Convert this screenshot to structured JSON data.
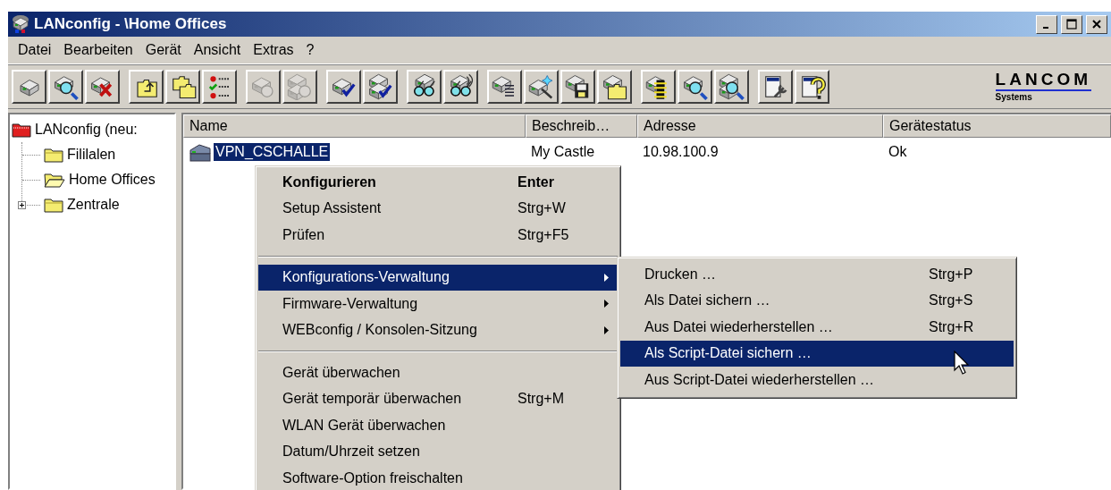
{
  "window": {
    "title": "LANconfig - \\Home Offices"
  },
  "menu_bar": [
    "Datei",
    "Bearbeiten",
    "Gerät",
    "Ansicht",
    "Extras",
    "?"
  ],
  "toolbar": [
    {
      "buttons": [
        {
          "kind": "device",
          "disabled": false
        },
        {
          "kind": "device-search",
          "disabled": false
        },
        {
          "kind": "device-delete",
          "disabled": false
        }
      ]
    },
    {
      "buttons": [
        {
          "kind": "folder-up",
          "disabled": false
        },
        {
          "kind": "folders",
          "disabled": false
        },
        {
          "kind": "checklist",
          "disabled": false
        }
      ]
    },
    {
      "buttons": [
        {
          "kind": "device-link",
          "disabled": true
        },
        {
          "kind": "devices-link",
          "disabled": true
        }
      ]
    },
    {
      "buttons": [
        {
          "kind": "device-check",
          "disabled": false
        },
        {
          "kind": "devices-check",
          "disabled": false
        }
      ]
    },
    {
      "buttons": [
        {
          "kind": "glasses",
          "disabled": false
        },
        {
          "kind": "glasses-wireless",
          "disabled": false
        }
      ]
    },
    {
      "buttons": [
        {
          "kind": "device-list",
          "disabled": false
        },
        {
          "kind": "device-sparkle",
          "disabled": false
        },
        {
          "kind": "device-save",
          "disabled": false
        },
        {
          "kind": "device-folder",
          "disabled": false
        }
      ]
    },
    {
      "buttons": [
        {
          "kind": "device-chip",
          "disabled": false
        },
        {
          "kind": "device-search",
          "disabled": false
        },
        {
          "kind": "devices-search",
          "disabled": false
        }
      ]
    },
    {
      "buttons": [
        {
          "kind": "page-wrench",
          "disabled": false
        },
        {
          "kind": "page-help",
          "disabled": false
        }
      ]
    }
  ],
  "logo": {
    "name": "LANCOM",
    "subtitle": "Systems"
  },
  "tree": {
    "label": "LANconfig (neu:",
    "children": [
      {
        "label": "Fililalen",
        "open": false,
        "expandable": false
      },
      {
        "label": "Home Offices",
        "open": true,
        "expandable": false
      },
      {
        "label": "Zentrale",
        "open": false,
        "expandable": true
      }
    ]
  },
  "table": {
    "columns": [
      "Name",
      "Beschreib…",
      "Adresse",
      "Gerätestatus"
    ],
    "rows": [
      {
        "cells": [
          "VPN_CSCHALLE",
          "My Castle",
          "10.98.100.9",
          "Ok"
        ],
        "selected": true
      }
    ]
  },
  "context_menu": {
    "items": [
      {
        "kind": "item",
        "label": "Konfigurieren",
        "shortcut": "Enter",
        "default": true,
        "submenu": false,
        "selected": false
      },
      {
        "kind": "item",
        "label": "Setup Assistent",
        "shortcut": "Strg+W",
        "default": false,
        "submenu": false,
        "selected": false
      },
      {
        "kind": "item",
        "label": "Prüfen",
        "shortcut": "Strg+F5",
        "default": false,
        "submenu": false,
        "selected": false
      },
      {
        "kind": "separator"
      },
      {
        "kind": "item",
        "label": "Konfigurations-Verwaltung",
        "default": false,
        "submenu": true,
        "selected": true
      },
      {
        "kind": "item",
        "label": "Firmware-Verwaltung",
        "default": false,
        "submenu": true,
        "selected": false
      },
      {
        "kind": "item",
        "label": "WEBconfig / Konsolen-Sitzung",
        "default": false,
        "submenu": true,
        "selected": false
      },
      {
        "kind": "separator"
      },
      {
        "kind": "item",
        "label": "Gerät überwachen",
        "default": false,
        "submenu": false,
        "selected": false
      },
      {
        "kind": "item",
        "label": "Gerät temporär überwachen",
        "shortcut": "Strg+M",
        "default": false,
        "submenu": false,
        "selected": false
      },
      {
        "kind": "item",
        "label": "WLAN Gerät überwachen",
        "default": false,
        "submenu": false,
        "selected": false
      },
      {
        "kind": "item",
        "label": "Datum/Uhrzeit setzen",
        "default": false,
        "submenu": false,
        "selected": false
      },
      {
        "kind": "item",
        "label": "Software-Option freischalten",
        "default": false,
        "submenu": false,
        "selected": false
      }
    ]
  },
  "submenu": {
    "items": [
      {
        "kind": "item",
        "label": "Drucken …",
        "shortcut": "Strg+P",
        "default": false,
        "submenu": false,
        "selected": false
      },
      {
        "kind": "item",
        "label": "Als Datei sichern …",
        "shortcut": "Strg+S",
        "default": false,
        "submenu": false,
        "selected": false
      },
      {
        "kind": "item",
        "label": "Aus Datei wiederherstellen …",
        "shortcut": "Strg+R",
        "default": false,
        "submenu": false,
        "selected": false
      },
      {
        "kind": "item",
        "label": "Als Script-Datei sichern …",
        "default": false,
        "submenu": false,
        "selected": true
      },
      {
        "kind": "item",
        "label": "Aus Script-Datei wiederherstellen …",
        "default": false,
        "submenu": false,
        "selected": false
      }
    ]
  }
}
